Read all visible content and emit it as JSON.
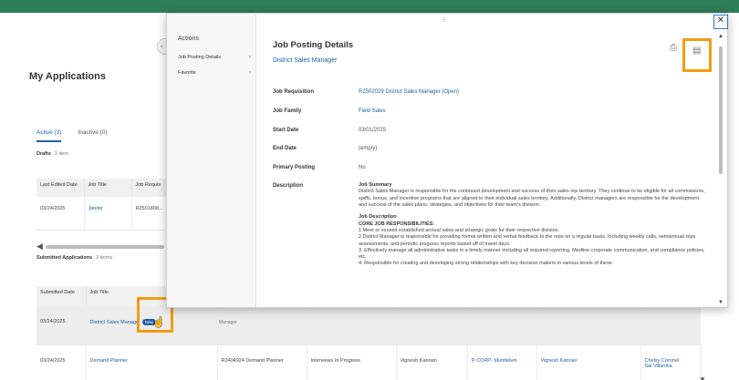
{
  "background": {
    "page_title": "My Applications",
    "tabs": [
      {
        "label": "Active (3)",
        "active": true
      },
      {
        "label": "Inactive (0)",
        "active": false
      }
    ],
    "drafts": {
      "label": "Drafts",
      "count": "1 item",
      "columns": [
        "Last Edited Date",
        "Job Title",
        "Job Requis"
      ],
      "rows": [
        {
          "date": "03/24/2025",
          "title": "Janitor",
          "requisition": "R2501808..."
        }
      ]
    },
    "submitted": {
      "label": "Submitted Applications",
      "count": "2 items",
      "columns": [
        "Submitted Date",
        "Job Title"
      ],
      "rows": [
        {
          "date": "03/24/2025",
          "title": "District Sales Manager",
          "badge": "New",
          "fragment": "Manager"
        },
        {
          "date": "03/24/2025",
          "title": "Demand Planner",
          "requisition": "R2404924 Demand Planner",
          "status": "Interviews In Progress",
          "recruiter": "Vignesh Kannan",
          "location": "CORP- Mundelein",
          "contact": "Vignesh Kannan",
          "other_line1": "Chelsy Coronel",
          "other_line2": "Sal Villarrilia"
        }
      ]
    }
  },
  "modal": {
    "side_header": "Actions",
    "side_items": [
      {
        "label": "Job Posting Details"
      },
      {
        "label": "Favorite"
      }
    ],
    "title": "Job Posting Details",
    "subtitle": "District Sales Manager",
    "fields": [
      {
        "label": "Job Requisition",
        "value": "R2502029 District Sales Manager (Open)",
        "link": true
      },
      {
        "label": "Job Family",
        "value": "Field Sales",
        "link": true
      },
      {
        "label": "Start Date",
        "value": "03/01/2025",
        "link": false
      },
      {
        "label": "End Date",
        "value": "(empty)",
        "link": false
      },
      {
        "label": "Primary Posting",
        "value": "No",
        "link": false
      },
      {
        "label": "Description",
        "value": "",
        "link": false
      }
    ],
    "description": {
      "summary_heading": "Job Summary",
      "summary_text": "District Sales Manager is responsible for the continued development and success of their sales rep territory. They continue to be eligible for all commissions, spiffs, bonus, and incentive programs that are aligned to their individual sales territory. Additionally, District managers are responsible for the development and success of the sales plans, strategies, and objectives for their team's division.",
      "desc_heading": "Job Description",
      "core_heading": "CORE JOB RESPONSIBILITIES:",
      "items": [
        "1.Meet or exceed established annual sales and strategic goals for their respective division.",
        "2.District Manager is responsible for providing formal written and verbal feedback to the reps on a regular basis. Including weekly calls, semiannual reps assessments, and periodic progress reports based off of travel days.",
        "3. Effectively manage all administrative tasks in a timely manner including all required reporting, Medline corporate communication, and compliance policies, etc.",
        "4. Responsible for creating and developing strong relationships with key decision makers in various levels of these"
      ]
    },
    "icons": {
      "print": "print-icon",
      "export": "export-icon",
      "close": "close-icon"
    }
  },
  "colors": {
    "accent": "#1e5fa8",
    "highlight": "#f39c12",
    "topbar": "#2e7d5b"
  }
}
